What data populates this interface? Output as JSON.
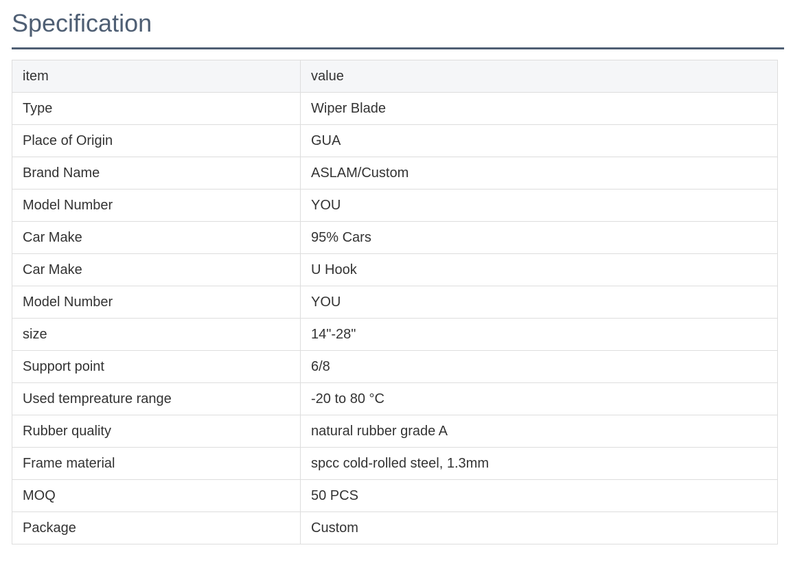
{
  "section": {
    "title": "Specification"
  },
  "table": {
    "header": {
      "item": "item",
      "value": "value"
    },
    "rows": [
      {
        "item": "Type",
        "value": "Wiper Blade"
      },
      {
        "item": "Place of Origin",
        "value": "GUA"
      },
      {
        "item": "Brand Name",
        "value": "ASLAM/Custom"
      },
      {
        "item": "Model Number",
        "value": "YOU"
      },
      {
        "item": "Car Make",
        "value": "95% Cars"
      },
      {
        "item": "Car Make",
        "value": "U Hook"
      },
      {
        "item": "Model Number",
        "value": "YOU"
      },
      {
        "item": "size",
        "value": "14\"-28\""
      },
      {
        "item": "Support point",
        "value": "6/8"
      },
      {
        "item": "Used tempreature range",
        "value": "-20 to 80 °C"
      },
      {
        "item": "Rubber quality",
        "value": "natural rubber grade A"
      },
      {
        "item": "Frame material",
        "value": "spcc cold-rolled steel, 1.3mm"
      },
      {
        "item": "MOQ",
        "value": "50 PCS"
      },
      {
        "item": "Package",
        "value": "Custom"
      }
    ]
  },
  "colors": {
    "title": "#4f5f74",
    "rule": "#4f5f74",
    "header_bg": "#f5f6f8",
    "border": "#dddddd",
    "text": "#333333"
  }
}
